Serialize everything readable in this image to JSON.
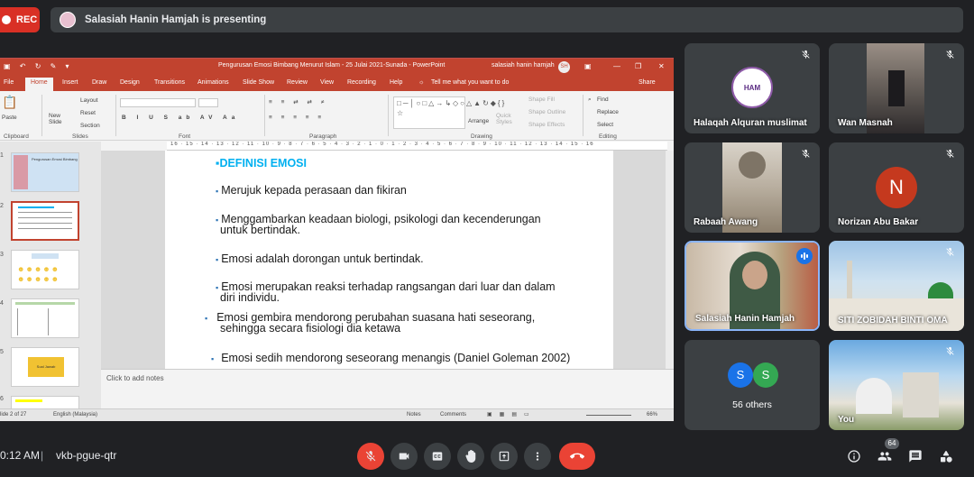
{
  "meeting": {
    "rec_label": "REC",
    "presenting_text": "Salasiah Hanin Hamjah is presenting",
    "time": "0:12 AM",
    "separator": "|",
    "meeting_code": "vkb-pgue-qtr",
    "participant_badge": "64"
  },
  "powerpoint": {
    "window_title": "Pengurusan Emosi Bimbang Menurut Islam - 25 Julai 2021-Sunada  -  PowerPoint",
    "user_name": "salasiah hanin hamjah",
    "user_initials": "SH",
    "tabs": [
      "File",
      "Home",
      "Insert",
      "Draw",
      "Design",
      "Transitions",
      "Animations",
      "Slide Show",
      "Review",
      "View",
      "Recording",
      "Help"
    ],
    "tell_me": "Tell me what you want to do",
    "share": "Share",
    "ribbon": {
      "paste": "Paste",
      "new_slide": "New\nSlide",
      "layout": "Layout",
      "reset": "Reset",
      "section": "Section",
      "arrange": "Arrange",
      "quick_styles": "Quick\nStyles",
      "shape_fill": "Shape Fill",
      "shape_outline": "Shape Outline",
      "shape_effects": "Shape Effects",
      "find": "Find",
      "replace": "Replace",
      "select": "Select",
      "groups": [
        "Clipboard",
        "Slides",
        "Font",
        "Paragraph",
        "Drawing",
        "Editing"
      ]
    },
    "ruler": "16 · 15 · 14 · 13 · 12 · 11 · 10 · 9 · 8 · 7 · 6 · 5 · 4 · 3 · 2 · 1 · 0 · 1 · 2 · 3 · 4 · 5 · 6 · 7 · 8 · 9 · 10 · 11 · 12 · 13 · 14 · 15 · 16",
    "thumb_numbers": [
      "1",
      "2",
      "3",
      "4",
      "5",
      "6"
    ],
    "thumb_labels": {
      "thumb1": "Pengurusan Emosi Bimbang",
      "thumb5": "Soal Jawab"
    },
    "slide": {
      "heading": "DEFINISI EMOSI",
      "bullets": [
        "Merujuk kepada perasaan dan fikiran",
        "Menggambarkan keadaan biologi, psikologi dan kecenderungan",
        "untuk bertindak.",
        "Emosi adalah dorongan untuk bertindak.",
        "Emosi merupakan reaksi terhadap rangsangan dari luar dan dalam",
        "diri individu.",
        "Emosi gembira mendorong perubahan suasana hati seseorang,",
        "sehingga secara fisiologi dia ketawa",
        "Emosi sedih mendorong seseorang menangis (Daniel Goleman 2002)"
      ]
    },
    "notes_placeholder": "Click to add notes",
    "status": {
      "slide_count": "lide 2 of 27",
      "language": "English (Malaysia)",
      "notes": "Notes",
      "comments": "Comments",
      "zoom": "66%"
    }
  },
  "participants": [
    {
      "name": "Halaqah Alquran muslimat",
      "muted": true,
      "logo_text": "HAM"
    },
    {
      "name": "Wan Masnah",
      "muted": true
    },
    {
      "name": "Rabaah Awang",
      "muted": true
    },
    {
      "name": "Norizan Abu Bakar",
      "muted": true,
      "initial": "N",
      "color": "#c5391e"
    },
    {
      "name": "Salasiah Hanin Hamjah",
      "speaking": true
    },
    {
      "name": "SITI ZOBIDAH BINTI OMA",
      "muted": true
    },
    {
      "name": "56 others",
      "avatars": [
        "S",
        "S"
      ],
      "avatar_colors": [
        "#1a73e8",
        "#34a853"
      ]
    },
    {
      "name": "You",
      "muted": true
    }
  ]
}
